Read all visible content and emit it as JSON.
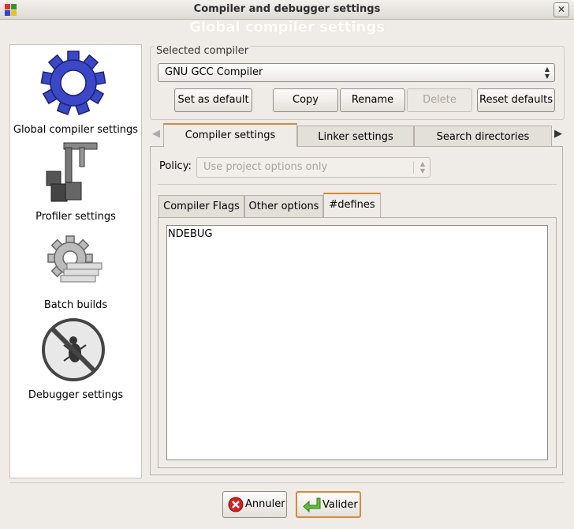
{
  "window": {
    "title": "Compiler and debugger settings",
    "banner": "Global compiler settings"
  },
  "sidebar": {
    "items": [
      {
        "label": "Global compiler settings",
        "icon": "gear-icon"
      },
      {
        "label": "Profiler settings",
        "icon": "caliper-icon"
      },
      {
        "label": "Batch builds",
        "icon": "batch-gear-icon"
      },
      {
        "label": "Debugger settings",
        "icon": "no-bug-icon"
      }
    ]
  },
  "compiler": {
    "group_label": "Selected compiler",
    "selected": "GNU GCC Compiler",
    "buttons": {
      "set_default": "Set as default",
      "copy": "Copy",
      "rename": "Rename",
      "delete": "Delete",
      "reset": "Reset defaults"
    }
  },
  "tabs": [
    "Compiler settings",
    "Linker settings",
    "Search directories"
  ],
  "policy": {
    "label": "Policy:",
    "value": "Use project options only"
  },
  "inner_tabs": [
    "Compiler Flags",
    "Other options",
    "#defines"
  ],
  "defines_text": "NDEBUG",
  "footer": {
    "cancel": "Annuler",
    "ok": "Valider"
  },
  "colors": {
    "accent": "#d58a3d",
    "gear_blue": "#3a48c8"
  }
}
